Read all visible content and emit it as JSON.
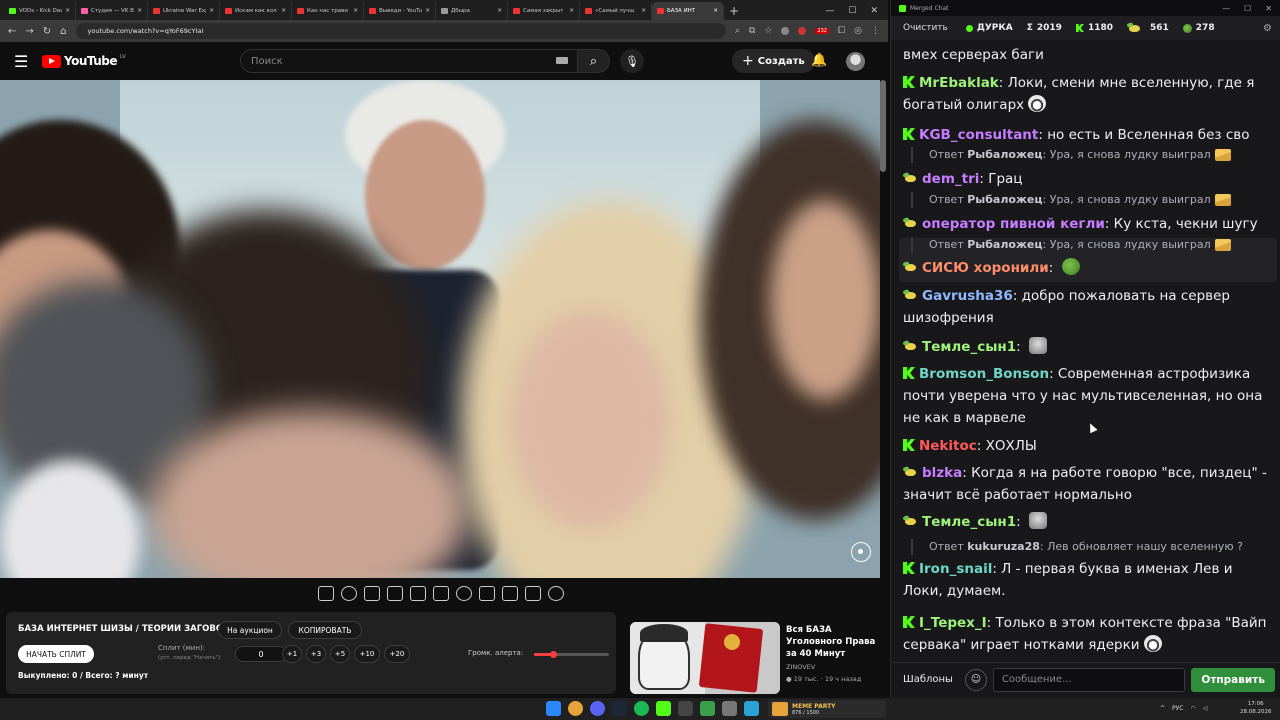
{
  "browser": {
    "tabs": [
      {
        "label": "VODs - Kick Dash",
        "icon": "kick-favicon",
        "active": false
      },
      {
        "label": "Студия — VK Видео",
        "icon": "vk-favicon",
        "active": false
      },
      {
        "label": "Ukraine War Exp",
        "icon": "youtube-favicon",
        "active": false
      },
      {
        "label": "Искам как кол",
        "icon": "youtube-favicon",
        "active": false
      },
      {
        "label": "Как нас трави",
        "icon": "youtube-favicon",
        "active": false
      },
      {
        "label": "Выведи - YouTube",
        "icon": "youtube-favicon",
        "active": false
      },
      {
        "label": "Дбыра",
        "icon": "generic-favicon",
        "active": false
      },
      {
        "label": "Самая закрыт",
        "icon": "youtube-favicon",
        "active": false
      },
      {
        "label": "«Самый лучш",
        "icon": "youtube-favicon",
        "active": false
      },
      {
        "label": "БАЗА ИНТ",
        "icon": "youtube-favicon",
        "active": true
      }
    ],
    "new_tab": "+",
    "url": "youtube.com/watch?v=qYoF69cYIaI",
    "ext_badge": "232"
  },
  "youtube": {
    "logo_text": "YouTube",
    "country_code": "LV",
    "search_placeholder": "Поиск",
    "create_label": "Создать",
    "panel": {
      "title": "БАЗА ИНТЕРНЕТ ШИЗЫ / ТЕОРИИ ЗАГОВОРОВ",
      "auction_label": "На аукцион",
      "copy_label": "КОПИРОВАТЬ",
      "start_split_label": "НАЧАТЬ СПЛИТ",
      "split_label": "Сплит (мин):",
      "split_hint": "(уст. перед \"Начать\")",
      "split_value": "0",
      "increments": [
        "+1",
        "+3",
        "+5",
        "+10",
        "+20"
      ],
      "paid_text": "Выкуплено: 0 / Всего: ? минут",
      "volume_label": "Громк. алерта:",
      "volume_level": 0.25
    },
    "recommended": {
      "title": "Вся БАЗА Уголовного Права за 40 Минут",
      "channel": "ZINOVEV",
      "meta": "19 тыс. · 19 ч назад"
    }
  },
  "chat": {
    "window_title": "Merged Chat",
    "clear_label": "Очистить",
    "channel_name": "ДУРКА",
    "stats": [
      {
        "prefix": "Σ",
        "value": "2019",
        "icon": "sum-icon"
      },
      {
        "prefix": "",
        "value": "1180",
        "icon": "kick-icon"
      },
      {
        "prefix": "",
        "value": "561",
        "icon": "duck-icon"
      },
      {
        "prefix": "",
        "value": "278",
        "icon": "frog-icon"
      }
    ],
    "messages": [
      {
        "type": "text",
        "text": "вмех серверах баги"
      },
      {
        "type": "msg",
        "platform": "kick",
        "user": "MrEbaklak",
        "color": "#9ef27a",
        "text": "Локи, смени мне вселенную, где я богатый олигарх",
        "emote": "face"
      },
      {
        "type": "msg",
        "platform": "kick",
        "user": "KGB_consultant",
        "color": "#c77dff",
        "text": "но есть и Вселенная без сво"
      },
      {
        "type": "reply",
        "prefix": "Ответ",
        "user": "Рыбаложец",
        "text": "Ура, я снова лудку выиграл",
        "emote": "env"
      },
      {
        "type": "msg",
        "platform": "duck",
        "user": "dem_tri",
        "color": "#c77dff",
        "text": "Грац"
      },
      {
        "type": "reply",
        "prefix": "Ответ",
        "user": "Рыбаложец",
        "text": "Ура, я снова лудку выиграл",
        "emote": "env"
      },
      {
        "type": "msg",
        "platform": "duck",
        "user": "оператор пивной кегли",
        "color": "#c77dff",
        "text": "Ку кста, чекни шугу"
      },
      {
        "type": "reply",
        "prefix": "Ответ",
        "user": "Рыбаложец",
        "text": "Ура, я снова лудку выиграл",
        "emote": "env"
      },
      {
        "type": "msg",
        "platform": "duck",
        "user": "СИСЮ хоронили",
        "color": "#ff8c69",
        "text": "",
        "emote": "frog"
      },
      {
        "type": "msg",
        "platform": "duck",
        "user": "Gavrusha36",
        "color": "#8fb8ff",
        "text": "добро пожаловать на сервер шизофрения"
      },
      {
        "type": "msg",
        "platform": "duck",
        "user": "Темле_сын1",
        "color": "#9ef27a",
        "text": "",
        "emote": "gray"
      },
      {
        "type": "msg",
        "platform": "kick",
        "user": "Bromson_Bonson",
        "color": "#6fd6c6",
        "text": "Современная астрофизика почти уверена что у нас мультивселенная, но она не как в марвеле"
      },
      {
        "type": "msg",
        "platform": "kick",
        "user": "Nekitoc",
        "color": "#ff5a5a",
        "text": "ХОХЛЫ"
      },
      {
        "type": "msg",
        "platform": "duck",
        "user": "blzka",
        "color": "#c77dff",
        "text": "Когда я на работе говорю \"все, пиздец\" - значит всё работает нормально"
      },
      {
        "type": "msg",
        "platform": "duck",
        "user": "Темле_сын1",
        "color": "#9ef27a",
        "text": "",
        "emote": "gray"
      },
      {
        "type": "reply",
        "prefix": "Ответ",
        "user": "kukuruza28",
        "text": "Лев обновляет нашу вселенную ?"
      },
      {
        "type": "msg",
        "platform": "kick",
        "user": "Iron_snail",
        "color": "#6fd6c6",
        "text": "Л - первая буква в именах Лев и Локи, думаем."
      },
      {
        "type": "msg",
        "platform": "kick",
        "user": "I_Tepex_I",
        "color": "#9ef27a",
        "text": "Только в этом контексте фраза \"Вайп сервака\" играет нотками ядерки",
        "emote": "face"
      }
    ],
    "templates_label": "Шаблоны",
    "input_placeholder": "Сообщение...",
    "send_label": "Отправить"
  },
  "taskbar": {
    "weather_title": "MEME PARTY",
    "weather_sub": "876 / 1500",
    "lang": "РУС",
    "time": "17:06",
    "date": "28.08.2026"
  },
  "colors": {
    "kick_green": "#53fc18",
    "youtube_red": "#ff0000",
    "send_green": "#2f8f3a"
  }
}
